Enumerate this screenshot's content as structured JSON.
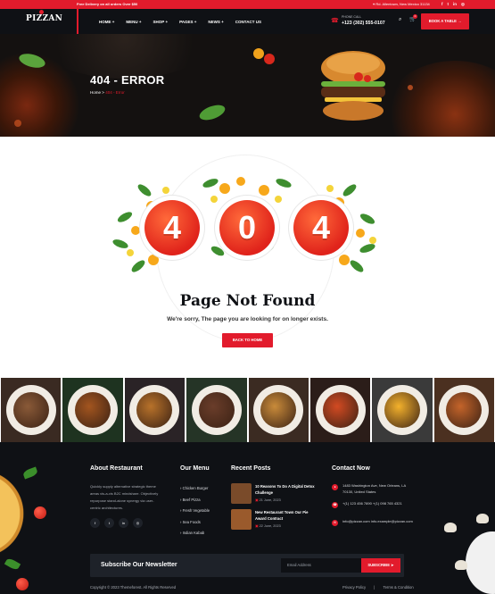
{
  "topbar": {
    "promo": "Free Delivery on all orders Over $50",
    "address": "Rd. Allentown, New Mexico 31134",
    "social": [
      "f",
      "t",
      "in",
      "◎"
    ]
  },
  "header": {
    "logo": "PIZZAN",
    "nav": [
      "HOME +",
      "MENU +",
      "SHOP +",
      "PAGES +",
      "NEWS +",
      "CONTACT US"
    ],
    "phone_label": "PHONE CALL",
    "phone_number": "+123 (302) 555-0107",
    "cart_count": "0",
    "book_label": "BOOK A TABLE →"
  },
  "hero": {
    "title": "404 - ERROR",
    "breadcrumb_home": "Home",
    "breadcrumb_sep": ">",
    "breadcrumb_current": "404 - Error"
  },
  "error": {
    "digits": [
      "4",
      "0",
      "4"
    ],
    "title": "Page Not Found",
    "message": "We're sorry, The page you are looking for on longer exists.",
    "button": "BACK TO HOME"
  },
  "gallery": [
    {
      "bg": "#3a2a22",
      "food": "#8a5a38"
    },
    {
      "bg": "#1e3320",
      "food": "#a3551f"
    },
    {
      "bg": "#2a2326",
      "food": "#b8722a"
    },
    {
      "bg": "#253426",
      "food": "#6a3d2a"
    },
    {
      "bg": "#3b2b22",
      "food": "#c98b3a"
    },
    {
      "bg": "#2b1d19",
      "food": "#d24a22"
    },
    {
      "bg": "#3a3a3a",
      "food": "#f3b12c"
    },
    {
      "bg": "#4b3020",
      "food": "#c4642a"
    }
  ],
  "footer": {
    "about_title": "About Restaurant",
    "about_text": "Quickly supply alternative strategic theme areas vis-a-vis B2C mindshare. Objectively repurpose stand-alone synergy via user-centric architectures.",
    "social": [
      "f",
      "t",
      "in",
      "◎"
    ],
    "menu_title": "Our Menu",
    "menu_items": [
      "Chicken Burger",
      "Beef Pizza",
      "Fresh Vegetable",
      "Sea Foods",
      "Indian Kabab"
    ],
    "posts_title": "Recent Posts",
    "posts": [
      {
        "title": "10 Reasons To Do A Digital Detox Challenge",
        "date": "21 June, 2023",
        "thumb": "#7a4b2a"
      },
      {
        "title": "New Restaurant Town Our Pie Award Contract",
        "date": "22 June, 2023",
        "thumb": "#9a5a2c"
      }
    ],
    "contact_title": "Contact Now",
    "contact": [
      {
        "icon": "●",
        "text": "1483 Washington Ave, New Orleans, LA 70130, United States"
      },
      {
        "icon": "☎",
        "text": "+(1) 123 456 7890 +(1) 098 765 4321"
      },
      {
        "icon": "✉",
        "text": "info@pizzan.com info.example@pizzan.com"
      }
    ],
    "newsletter_title": "Subscribe Our Newsletter",
    "email_placeholder": "Email Address",
    "subscribe_label": "SUBSCRIBE ➤",
    "copyright": "Copyright © 2023 Themeforest. All Rights Reserved",
    "legal": [
      "Privacy Policy",
      "|",
      "Terms & Condition"
    ]
  },
  "colors": {
    "accent": "#e21b2c",
    "dark": "#0f1115"
  }
}
